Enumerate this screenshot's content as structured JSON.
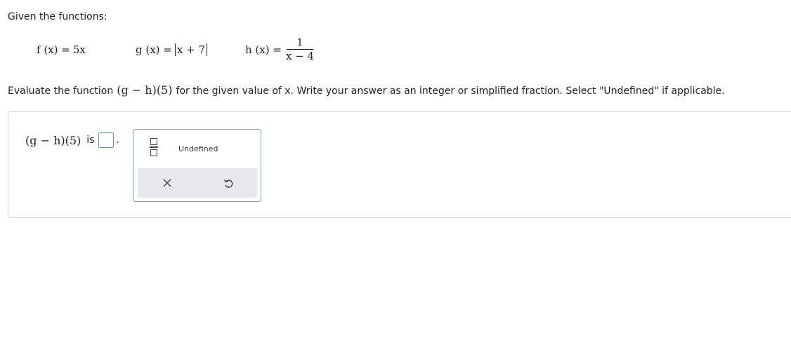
{
  "intro": "Given the functions:",
  "functions": {
    "f": {
      "lhs": "f (x) =",
      "rhs": "5x"
    },
    "g": {
      "lhs": "g (x) =",
      "abs_content": "x + 7"
    },
    "h": {
      "lhs": "h (x) =",
      "numerator": "1",
      "denominator": "x − 4"
    }
  },
  "instructions": {
    "before": "Evaluate the function",
    "expr": "(g − h)(5)",
    "after": "for the given value of x. Write your answer as an integer or simplified fraction. Select \"Undefined\" if applicable."
  },
  "answer": {
    "expr": "(g − h)(5)",
    "is_text": "is",
    "value": "",
    "period": "."
  },
  "toolpad": {
    "undefined_label": "Undefined",
    "icons": {
      "fraction": "fraction-icon",
      "clear": "close-icon",
      "undo": "undo-icon"
    }
  },
  "colors": {
    "input_border": "#4aa3df",
    "toolbar_bg": "#e6e9ec",
    "panel_border": "#d9d9d9"
  }
}
